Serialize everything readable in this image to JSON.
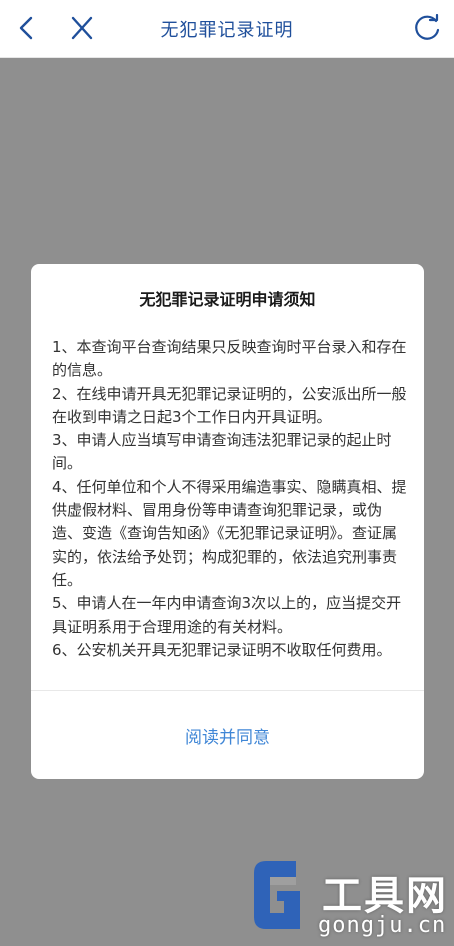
{
  "nav": {
    "title": "无犯罪记录证明",
    "back_icon": "chevron-left-icon",
    "close_icon": "close-icon",
    "refresh_icon": "refresh-icon",
    "accent_color": "#1f4f9b"
  },
  "dialog": {
    "title": "无犯罪记录证明申请须知",
    "items": [
      "1、本查询平台查询结果只反映查询时平台录入和存在的信息。",
      "2、在线申请开具无犯罪记录证明的，公安派出所一般在收到申请之日起3个工作日内开具证明。",
      "3、申请人应当填写申请查询违法犯罪记录的起止时间。",
      "4、任何单位和个人不得采用编造事实、隐瞒真相、提供虚假材料、冒用身份等申请查询犯罪记录，或伪造、变造《查询告知函》《无犯罪记录证明》。查证属实的，依法给予处罚；构成犯罪的，依法追究刑事责任。",
      "5、申请人在一年内申请查询3次以上的，应当提交开具证明系用于合理用途的有关材料。",
      "6、公安机关开具无犯罪记录证明不收取任何费用。"
    ],
    "agree_label": "阅读并同意",
    "agree_color": "#3f86d6"
  },
  "watermark": {
    "name": "工具网",
    "url": "gongju.cn",
    "logo_icon": "gongju-logo-icon"
  }
}
